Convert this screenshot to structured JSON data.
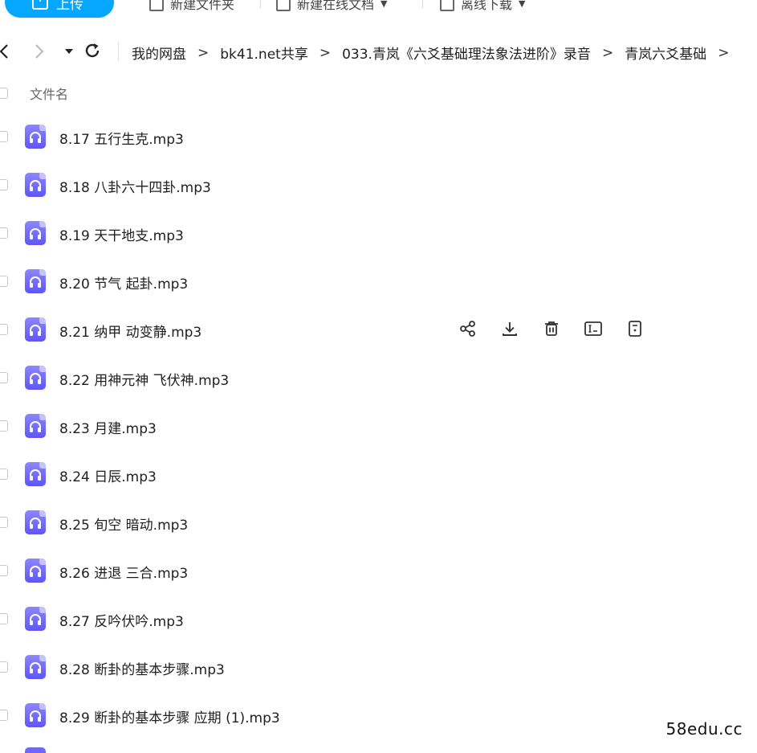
{
  "toolbar": {
    "upload_label": "上传",
    "new_folder_label": "新建文件夹",
    "new_online_doc_label": "新建在线文档",
    "offline_download_label": "离线下载"
  },
  "nav": {
    "back_icon": "chevron-left-icon",
    "forward_icon": "chevron-right-icon",
    "refresh_icon": "refresh-icon",
    "breadcrumb": [
      "我的网盘",
      "bk41.net共享",
      "033.青岚《六爻基础理法象法进阶》录音",
      "青岚六爻基础"
    ],
    "separator": ">"
  },
  "list_header": {
    "name_column": "文件名"
  },
  "files": [
    {
      "name": "8.17 五行生克.mp3"
    },
    {
      "name": "8.18 八卦六十四卦.mp3"
    },
    {
      "name": "8.19 天干地支.mp3"
    },
    {
      "name": "8.20 节气 起卦.mp3"
    },
    {
      "name": "8.21 纳甲 动变静.mp3"
    },
    {
      "name": "8.22 用神元神 飞伏神.mp3"
    },
    {
      "name": "8.23 月建.mp3"
    },
    {
      "name": "8.24 日辰.mp3"
    },
    {
      "name": "8.25 旬空 暗动.mp3"
    },
    {
      "name": "8.26 进退 三合.mp3"
    },
    {
      "name": "8.27 反吟伏吟.mp3"
    },
    {
      "name": "8.28 断卦的基本步骤.mp3"
    },
    {
      "name": "8.29 断卦的基本步骤 应期 (1).mp3"
    }
  ],
  "hover_row_actions": [
    "share-icon",
    "download-icon",
    "delete-icon",
    "rename-icon",
    "more-icon"
  ],
  "watermark": "58edu.cc",
  "colors": {
    "accent": "#06a7ff",
    "audio_icon": "#6f68f7"
  }
}
